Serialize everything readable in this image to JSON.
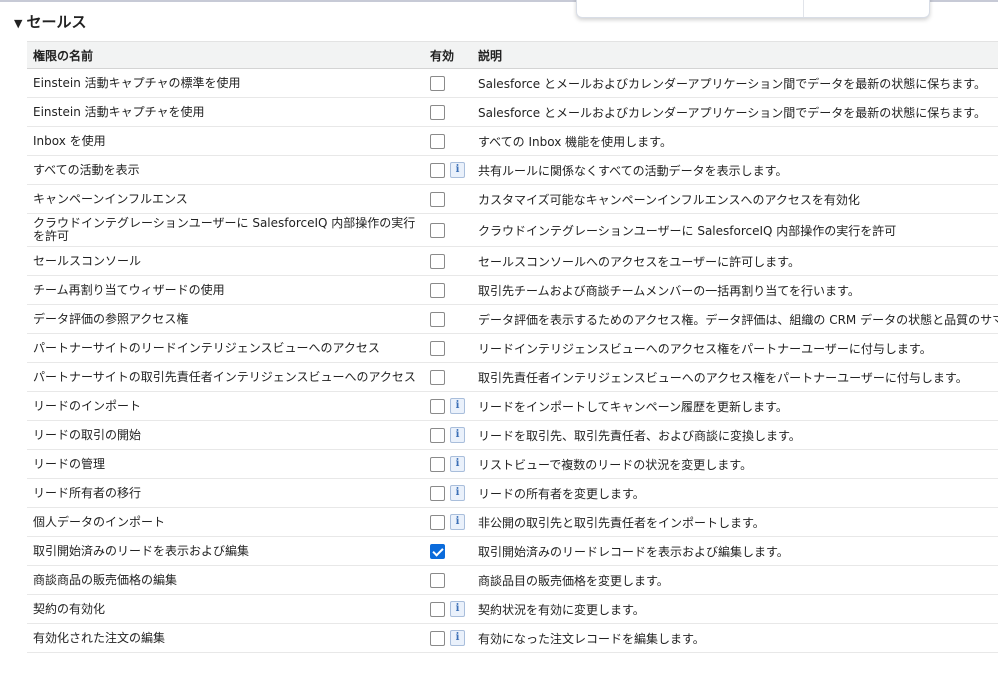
{
  "section": {
    "title": "セールス"
  },
  "table": {
    "headers": {
      "name": "権限の名前",
      "enabled": "有効",
      "description": "説明"
    },
    "rows": [
      {
        "name": "Einstein 活動キャプチャの標準を使用",
        "checked": false,
        "info": false,
        "description": "Salesforce とメールおよびカレンダーアプリケーション間でデータを最新の状態に保ちます。"
      },
      {
        "name": "Einstein 活動キャプチャを使用",
        "checked": false,
        "info": false,
        "description": "Salesforce とメールおよびカレンダーアプリケーション間でデータを最新の状態に保ちます。"
      },
      {
        "name": "Inbox を使用",
        "checked": false,
        "info": false,
        "description": "すべての Inbox 機能を使用します。"
      },
      {
        "name": "すべての活動を表示",
        "checked": false,
        "info": true,
        "description": "共有ルールに関係なくすべての活動データを表示します。"
      },
      {
        "name": "キャンペーンインフルエンス",
        "checked": false,
        "info": false,
        "description": "カスタマイズ可能なキャンペーンインフルエンスへのアクセスを有効化"
      },
      {
        "name": "クラウドインテグレーションユーザーに SalesforceIQ 内部操作の実行を許可",
        "checked": false,
        "info": false,
        "description": "クラウドインテグレーションユーザーに SalesforceIQ 内部操作の実行を許可"
      },
      {
        "name": "セールスコンソール",
        "checked": false,
        "info": false,
        "description": "セールスコンソールへのアクセスをユーザーに許可します。"
      },
      {
        "name": "チーム再割り当てウィザードの使用",
        "checked": false,
        "info": false,
        "description": "取引先チームおよび商談チームメンバーの一括再割り当てを行います。"
      },
      {
        "name": "データ評価の参照アクセス権",
        "checked": false,
        "info": false,
        "description": "データ評価を表示するためのアクセス権。データ評価は、組織の CRM データの状態と品質のサマ"
      },
      {
        "name": "パートナーサイトのリードインテリジェンスビューへのアクセス",
        "checked": false,
        "info": false,
        "description": "リードインテリジェンスビューへのアクセス権をパートナーユーザーに付与します。"
      },
      {
        "name": "パートナーサイトの取引先責任者インテリジェンスビューへのアクセス",
        "checked": false,
        "info": false,
        "description": "取引先責任者インテリジェンスビューへのアクセス権をパートナーユーザーに付与します。"
      },
      {
        "name": "リードのインポート",
        "checked": false,
        "info": true,
        "description": "リードをインポートしてキャンペーン履歴を更新します。"
      },
      {
        "name": "リードの取引の開始",
        "checked": false,
        "info": true,
        "description": "リードを取引先、取引先責任者、および商談に変換します。"
      },
      {
        "name": "リードの管理",
        "checked": false,
        "info": true,
        "description": "リストビューで複数のリードの状況を変更します。"
      },
      {
        "name": "リード所有者の移行",
        "checked": false,
        "info": true,
        "description": "リードの所有者を変更します。"
      },
      {
        "name": "個人データのインポート",
        "checked": false,
        "info": true,
        "description": "非公開の取引先と取引先責任者をインポートします。"
      },
      {
        "name": "取引開始済みのリードを表示および編集",
        "checked": true,
        "info": false,
        "description": "取引開始済みのリードレコードを表示および編集します。"
      },
      {
        "name": "商談商品の販売価格の編集",
        "checked": false,
        "info": false,
        "description": "商談品目の販売価格を変更します。"
      },
      {
        "name": "契約の有効化",
        "checked": false,
        "info": true,
        "description": "契約状況を有効に変更します。"
      },
      {
        "name": "有効化された注文の編集",
        "checked": false,
        "info": true,
        "description": "有効になった注文レコードを編集します。"
      }
    ]
  },
  "colors": {
    "checked": "#0b6bdb",
    "header_bg": "#f2f3f3",
    "info_icon": "#3b6fb6"
  }
}
